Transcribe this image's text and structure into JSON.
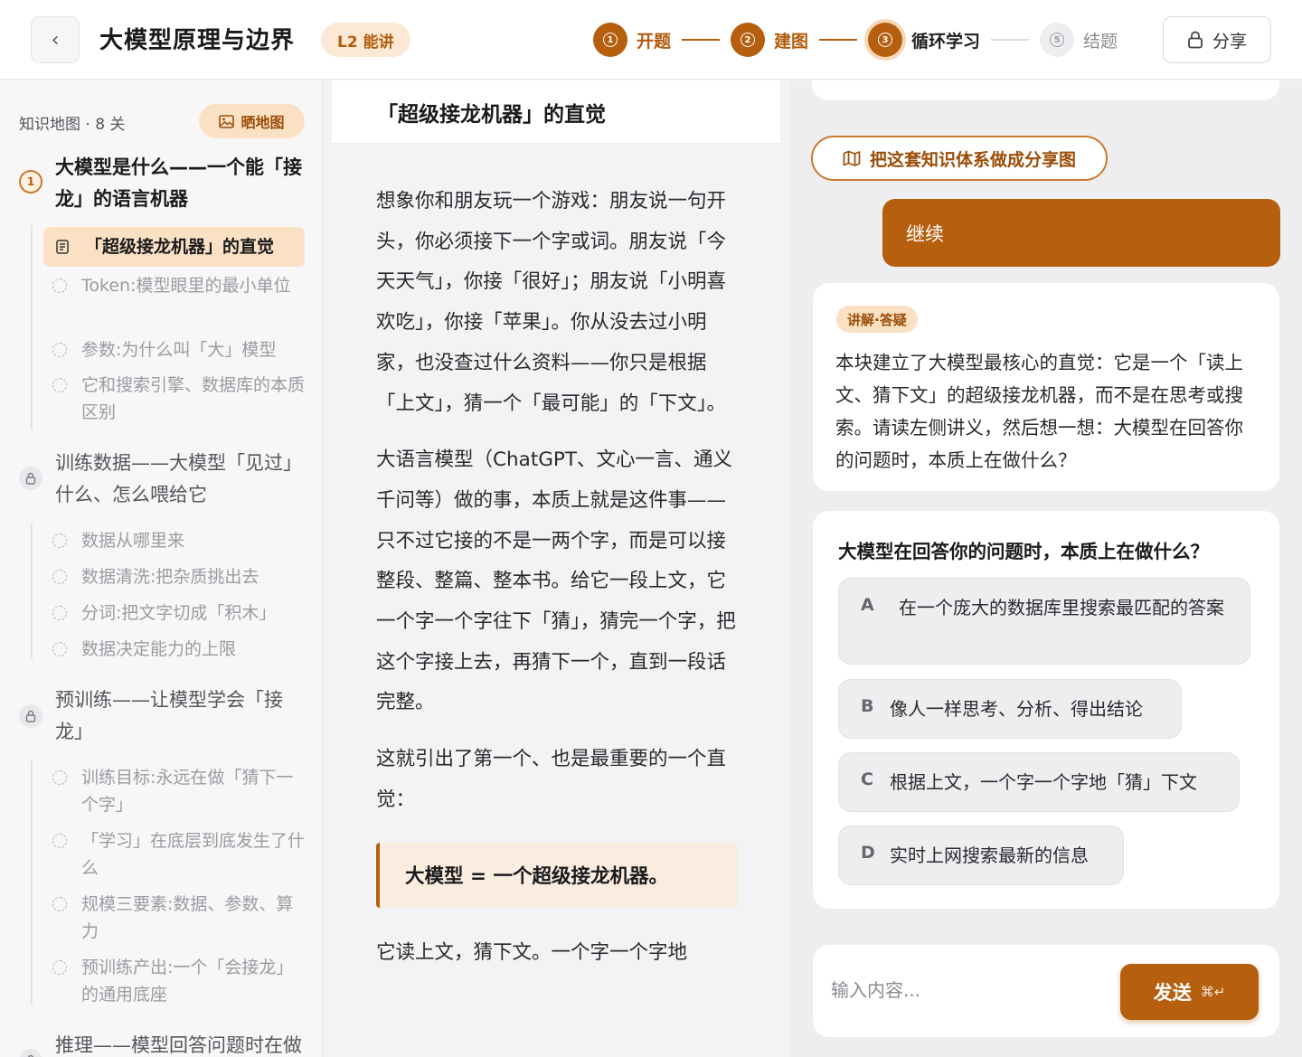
{
  "header": {
    "back_glyph": "‹",
    "title": "大模型原理与边界",
    "level_badge": "L2 能讲",
    "steps": [
      {
        "num": "1",
        "label": "开题",
        "state": "done"
      },
      {
        "num": "2",
        "label": "建图",
        "state": "done"
      },
      {
        "num": "3",
        "label": "循环学习",
        "state": "current"
      },
      {
        "num": "5",
        "label": "结题",
        "state": "pending"
      }
    ],
    "share_label": "分享",
    "accent_color": "#b55f0f"
  },
  "sidebar": {
    "map_title": "知识地图 · 8 关",
    "map_button": "晒地图",
    "chapters": [
      {
        "icon": "1",
        "title": "大模型是什么——一个能「接龙」的语言机器",
        "items": [
          "「超级接龙机器」的直觉",
          "Token:模型眼里的最小单位",
          "参数:为什么叫「大」模型",
          "它和搜索引擎、数据库的本质区别"
        ]
      },
      {
        "title": "训练数据——大模型「见过」什么、怎么喂给它",
        "items": [
          "数据从哪里来",
          "数据清洗:把杂质挑出去",
          "分词:把文字切成「积木」",
          "数据决定能力的上限"
        ]
      },
      {
        "title": "预训练——让模型学会「接龙」",
        "items": [
          "训练目标:永远在做「猜下一个字」",
          "「学习」在底层到底发生了什么",
          "规模三要素:数据、参数、算力",
          "预训练产出:一个「会接龙」的通用底座"
        ]
      },
      {
        "title": "推理——模型回答问题时在做"
      }
    ]
  },
  "lesson": {
    "title": "「超级接龙机器」的直觉",
    "paragraphs": [
      "想象你和朋友玩一个游戏：朋友说一句开头，你必须接下一个字或词。朋友说「今天天气」，你接「很好」；朋友说「小明喜欢吃」，你接「苹果」。你从没去过小明家，也没查过什么资料——你只是根据「上文」，猜一个「最可能」的「下文」。",
      "大语言模型（ChatGPT、文心一言、通义千问等）做的事，本质上就是这件事——只不过它接的不是一两个字，而是可以接整段、整篇、整本书。给它一段上文，它一个字一个字往下「猜」，猜完一个字，把这个字接上去，再猜下一个，直到一段话完整。",
      "这就引出了第一个、也是最重要的一个直觉："
    ],
    "callout": "大模型 = 一个超级接龙机器。",
    "tail": "它读上文，猜下文。一个字一个字地"
  },
  "chat": {
    "share_map_button": "把这套知识体系做成分享图",
    "user_message": "继续",
    "ai_tag": "讲解·答疑",
    "ai_text": "本块建立了大模型最核心的直觉：它是一个「读上文、猜下文」的超级接龙机器，而不是在思考或搜索。请读左侧讲义，然后想一想：大模型在回答你的问题时，本质上在做什么？",
    "quiz": {
      "question": "大模型在回答你的问题时，本质上在做什么？",
      "options": [
        {
          "letter": "A",
          "text": "在一个庞大的数据库里搜索最匹配的答案"
        },
        {
          "letter": "B",
          "text": "像人一样思考、分析、得出结论"
        },
        {
          "letter": "C",
          "text": "根据上文，一个字一个字地「猜」下文"
        },
        {
          "letter": "D",
          "text": "实时上网搜索最新的信息"
        }
      ]
    },
    "composer": {
      "placeholder": "输入内容...",
      "send_label": "发送",
      "shortcut": "⌘↵"
    }
  }
}
